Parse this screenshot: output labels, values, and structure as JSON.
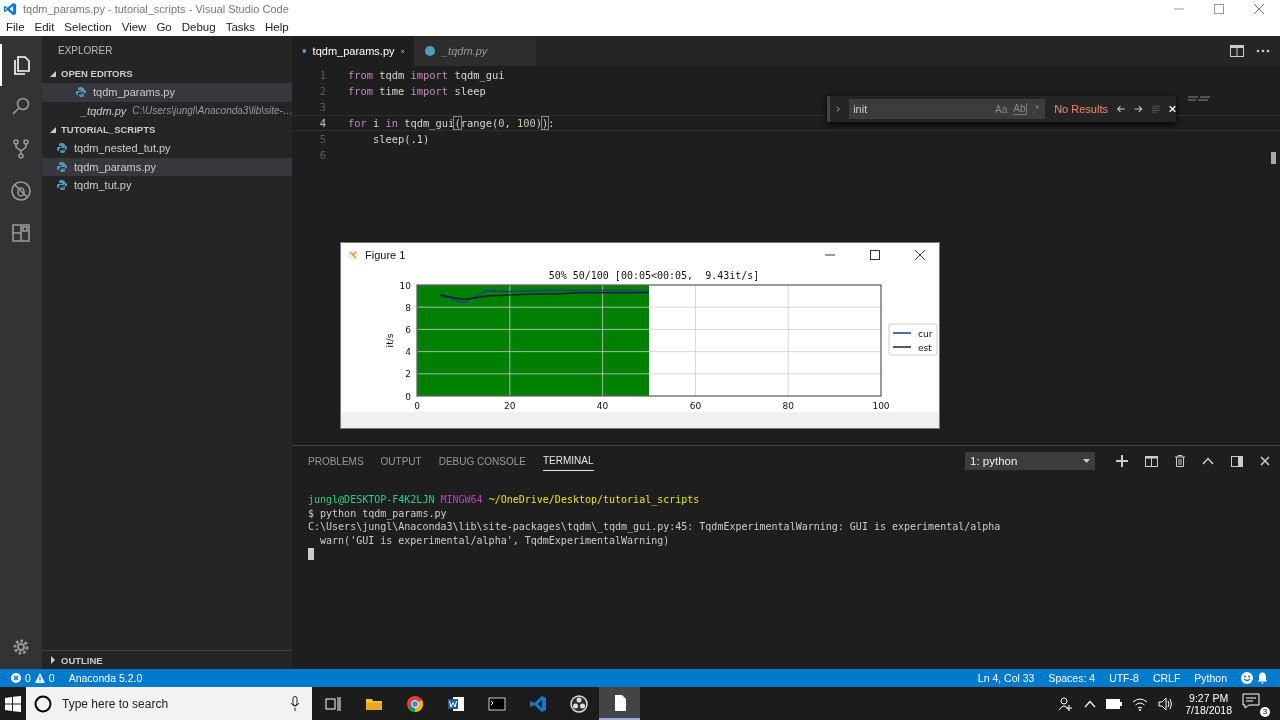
{
  "window": {
    "title": "tqdm_params.py - tutorial_scripts - Visual Studio Code"
  },
  "menu": [
    "File",
    "Edit",
    "Selection",
    "View",
    "Go",
    "Debug",
    "Tasks",
    "Help"
  ],
  "activity_bar": [
    {
      "kind": "files",
      "selected": true
    },
    {
      "kind": "search",
      "selected": false
    },
    {
      "kind": "source-control",
      "selected": false
    },
    {
      "kind": "debug",
      "selected": false
    },
    {
      "kind": "extensions",
      "selected": false
    }
  ],
  "sidebar": {
    "title": "EXPLORER",
    "sections": [
      {
        "title": "OPEN EDITORS",
        "expanded": true,
        "items": [
          {
            "name": "tqdm_params.py",
            "preview": false,
            "selected": true
          },
          {
            "name": "_tqdm.py",
            "preview": true,
            "path": "C:\\Users\\jungl\\Anaconda3\\lib\\site-…",
            "selected": false
          }
        ]
      },
      {
        "title": "TUTORIAL_SCRIPTS",
        "expanded": true,
        "items": [
          {
            "name": "tqdm_nested_tut.py",
            "preview": false,
            "selected": false
          },
          {
            "name": "tqdm_params.py",
            "preview": false,
            "selected": true
          },
          {
            "name": "tqdm_tut.py",
            "preview": false,
            "selected": false
          }
        ]
      }
    ],
    "outline": {
      "title": "OUTLINE",
      "expanded": false
    }
  },
  "editor_tabs": [
    {
      "label": "tqdm_params.py",
      "selected": true,
      "preview": false
    },
    {
      "label": "_tqdm.py",
      "selected": false,
      "preview": true
    }
  ],
  "code_lines": [
    {
      "number": "1",
      "current": false,
      "tokens": [
        {
          "kind": "kw",
          "text": "from"
        },
        {
          "kind": "text",
          "text": " tqdm "
        },
        {
          "kind": "kw",
          "text": "import"
        },
        {
          "kind": "text",
          "text": " tqdm_gui"
        }
      ]
    },
    {
      "number": "2",
      "current": false,
      "tokens": [
        {
          "kind": "kw",
          "text": "from"
        },
        {
          "kind": "text",
          "text": " time "
        },
        {
          "kind": "kw",
          "text": "import"
        },
        {
          "kind": "text",
          "text": " sleep"
        }
      ]
    },
    {
      "number": "3",
      "current": false
    },
    {
      "number": "4",
      "current": true,
      "tokens": [
        {
          "kind": "kw",
          "text": "for"
        },
        {
          "kind": "text",
          "text": " i "
        },
        {
          "kind": "kw",
          "text": "in"
        },
        {
          "kind": "text",
          "text": " tqdm_gui"
        },
        {
          "kind": "bracket",
          "text": "("
        },
        {
          "kind": "text",
          "text": "range("
        },
        {
          "kind": "num",
          "text": "0"
        },
        {
          "kind": "text",
          "text": ", "
        },
        {
          "kind": "num",
          "text": "100"
        },
        {
          "kind": "text",
          "text": ")"
        },
        {
          "kind": "bracket",
          "text": ")"
        },
        {
          "kind": "text",
          "text": ":"
        }
      ]
    },
    {
      "number": "5",
      "current": false,
      "tokens": [
        {
          "kind": "text",
          "text": "    sleep(.1)"
        }
      ]
    },
    {
      "number": "6",
      "current": false
    }
  ],
  "find_widget": {
    "value": "init",
    "options": [
      {
        "label": "Aa",
        "on": false
      },
      {
        "label": "Ab",
        "on": false
      },
      {
        "label": ".*",
        "on": false
      }
    ],
    "result": "No Results"
  },
  "figure": {
    "title": "Figure 1",
    "chart_data": {
      "type": "line",
      "title": "50% 50/100 [00:05<00:05,  9.43it/s]",
      "ylabel": "it/s",
      "x": [
        5,
        10,
        15,
        20,
        25,
        30,
        35,
        40,
        45,
        50
      ],
      "series": [
        {
          "name": "cur",
          "color": "#1f3d8f",
          "values": [
            9.1,
            8.4,
            9.5,
            9.4,
            9.5,
            9.5,
            9.5,
            9.5,
            9.5,
            9.4
          ]
        },
        {
          "name": "est",
          "color": "#222222",
          "values": [
            9.1,
            8.7,
            9.0,
            9.1,
            9.2,
            9.2,
            9.3,
            9.3,
            9.3,
            9.3
          ]
        }
      ],
      "xlim": [
        0,
        100
      ],
      "ylim": [
        0,
        10
      ],
      "xticks": [
        0,
        20,
        40,
        60,
        80,
        100
      ],
      "yticks": [
        0,
        2,
        4,
        6,
        8,
        10
      ],
      "grid": true,
      "legend": "right"
    },
    "progress": {
      "level": 0.5
    }
  },
  "panel": {
    "tabs": [
      {
        "label": "PROBLEMS",
        "selected": false
      },
      {
        "label": "OUTPUT",
        "selected": false
      },
      {
        "label": "DEBUG CONSOLE",
        "selected": false
      },
      {
        "label": "TERMINAL",
        "selected": true
      }
    ],
    "terminal_select": "1: python",
    "terminal_lines": [
      [
        {
          "kind": "user",
          "text": "jungl@DESKTOP-F4K2LJN"
        },
        {
          "kind": "system",
          "text": " MINGW64"
        },
        {
          "kind": "path",
          "text": " ~/OneDrive/Desktop/tutorial_scripts"
        }
      ],
      [
        {
          "kind": "text",
          "text": "$ python tqdm_params.py"
        }
      ],
      [
        {
          "kind": "text",
          "text": "C:\\Users\\jungl\\Anaconda3\\lib\\site-packages\\tqdm\\_tqdm_gui.py:45: TqdmExperimentalWarning: GUI is experimental/alpha"
        }
      ],
      [
        {
          "kind": "text",
          "text": "  warn('GUI is experimental/alpha', TqdmExperimentalWarning)"
        }
      ]
    ]
  },
  "status_bar": {
    "errors": "0",
    "warnings": "0",
    "left": [
      "Anaconda 5.2.0"
    ],
    "right": [
      "Ln 4, Col 33",
      "Spaces: 4",
      "UTF-8",
      "CRLF",
      "Python"
    ]
  },
  "taskbar": {
    "search": {
      "placeholder": "Type here to search"
    },
    "apps": [
      {
        "kind": "task-view",
        "selected": false
      },
      {
        "kind": "folder",
        "selected": false
      },
      {
        "kind": "browser",
        "selected": false
      },
      {
        "kind": "word",
        "selected": false
      },
      {
        "kind": "console",
        "selected": false
      },
      {
        "kind": "vscode",
        "selected": false
      },
      {
        "kind": "recorder",
        "selected": false
      },
      {
        "kind": "document",
        "selected": true
      }
    ],
    "time": "9:27 PM",
    "date": "7/18/2018",
    "notifications": "3"
  }
}
